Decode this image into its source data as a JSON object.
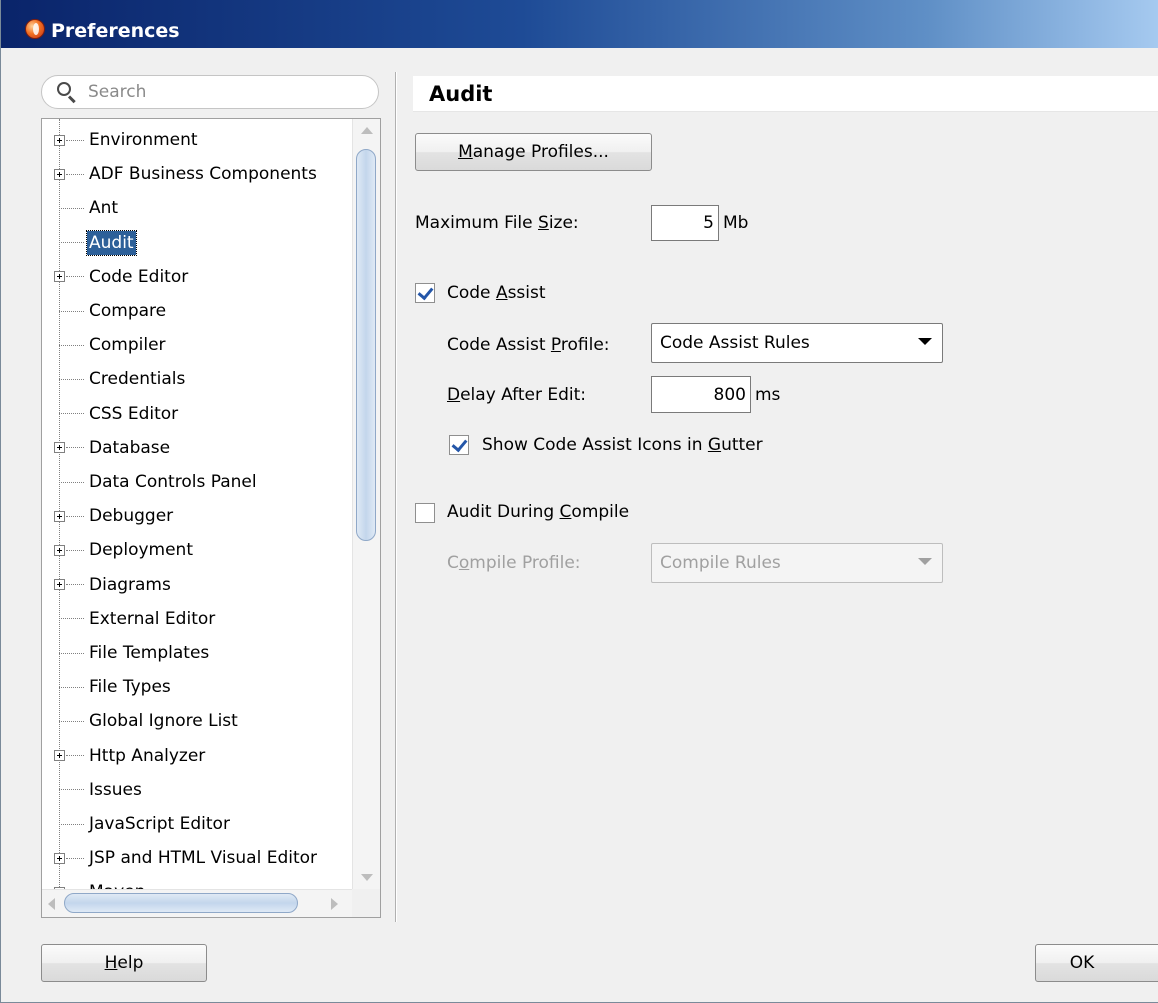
{
  "window": {
    "title": "Preferences"
  },
  "search": {
    "placeholder": "Search"
  },
  "tree": {
    "items": [
      {
        "label": "Environment",
        "expandable": true
      },
      {
        "label": "ADF Business Components",
        "expandable": true
      },
      {
        "label": "Ant",
        "expandable": false
      },
      {
        "label": "Audit",
        "expandable": false,
        "selected": true
      },
      {
        "label": "Code Editor",
        "expandable": true
      },
      {
        "label": "Compare",
        "expandable": false
      },
      {
        "label": "Compiler",
        "expandable": false
      },
      {
        "label": "Credentials",
        "expandable": false
      },
      {
        "label": "CSS Editor",
        "expandable": false
      },
      {
        "label": "Database",
        "expandable": true
      },
      {
        "label": "Data Controls Panel",
        "expandable": false
      },
      {
        "label": "Debugger",
        "expandable": true
      },
      {
        "label": "Deployment",
        "expandable": true
      },
      {
        "label": "Diagrams",
        "expandable": true
      },
      {
        "label": "External Editor",
        "expandable": false
      },
      {
        "label": "File Templates",
        "expandable": false
      },
      {
        "label": "File Types",
        "expandable": false
      },
      {
        "label": "Global Ignore List",
        "expandable": false
      },
      {
        "label": "Http Analyzer",
        "expandable": true
      },
      {
        "label": "Issues",
        "expandable": false
      },
      {
        "label": "JavaScript Editor",
        "expandable": false
      },
      {
        "label": "JSP and HTML Visual Editor",
        "expandable": true
      },
      {
        "label": "Maven",
        "expandable": true
      }
    ]
  },
  "audit": {
    "title": "Audit",
    "manage_profiles_pre": "",
    "manage_profiles_u": "M",
    "manage_profiles_post": "anage Profiles...",
    "max_file_size_pre": "Maximum File ",
    "max_file_size_u": "S",
    "max_file_size_post": "ize:",
    "max_file_size_value": "5",
    "max_file_size_unit": "Mb",
    "code_assist_pre": "Code ",
    "code_assist_u": "A",
    "code_assist_post": "ssist",
    "code_assist_checked": true,
    "code_assist_profile_pre": "Code Assist ",
    "code_assist_profile_u": "P",
    "code_assist_profile_post": "rofile:",
    "code_assist_profile_value": "Code Assist Rules",
    "delay_pre": "",
    "delay_u": "D",
    "delay_post": "elay After Edit:",
    "delay_value": "800",
    "delay_unit": "ms",
    "show_icons_pre": "Show Code Assist Icons in ",
    "show_icons_u": "G",
    "show_icons_post": "utter",
    "show_icons_checked": true,
    "audit_compile_pre": "Audit During ",
    "audit_compile_u": "C",
    "audit_compile_post": "ompile",
    "audit_compile_checked": false,
    "compile_profile_pre": "C",
    "compile_profile_u": "o",
    "compile_profile_post": "mpile Profile:",
    "compile_profile_value": "Compile Rules"
  },
  "footer": {
    "help_u": "H",
    "help_post": "elp",
    "ok_label": "OK"
  }
}
